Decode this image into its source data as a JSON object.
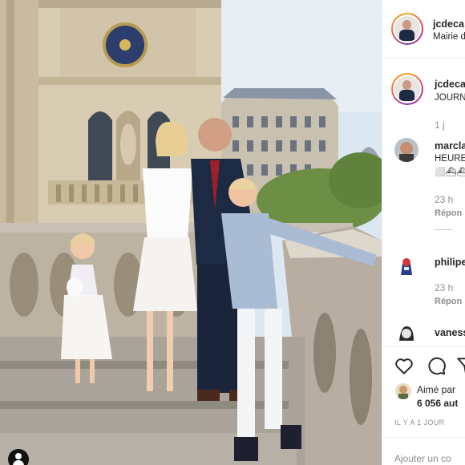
{
  "post": {
    "header_username": "jcdeca",
    "location": "Mairie d",
    "caption_username": "jcdeca",
    "caption_text": "JOURN",
    "caption_time": "1 j"
  },
  "comments": [
    {
      "username": "marcla",
      "lines": [
        "HEURE",
        "⬜⛴⛴⛴"
      ],
      "time": "23 h",
      "reply": "Répon"
    },
    {
      "username": "philipe",
      "time": "23 h",
      "reply": "Répon"
    },
    {
      "username": "vaness"
    }
  ],
  "likes": {
    "liked_by": "Aimé par",
    "count_text": "6 056 aut"
  },
  "time_ago": "IL Y A 1 JOUR",
  "add_comment_placeholder": "Ajouter un co",
  "icons": [
    "heart-icon",
    "comment-icon",
    "share-icon",
    "user-icon"
  ],
  "colors": {
    "muted": "#8e8e8e",
    "text": "#262626",
    "border": "#efefef"
  }
}
